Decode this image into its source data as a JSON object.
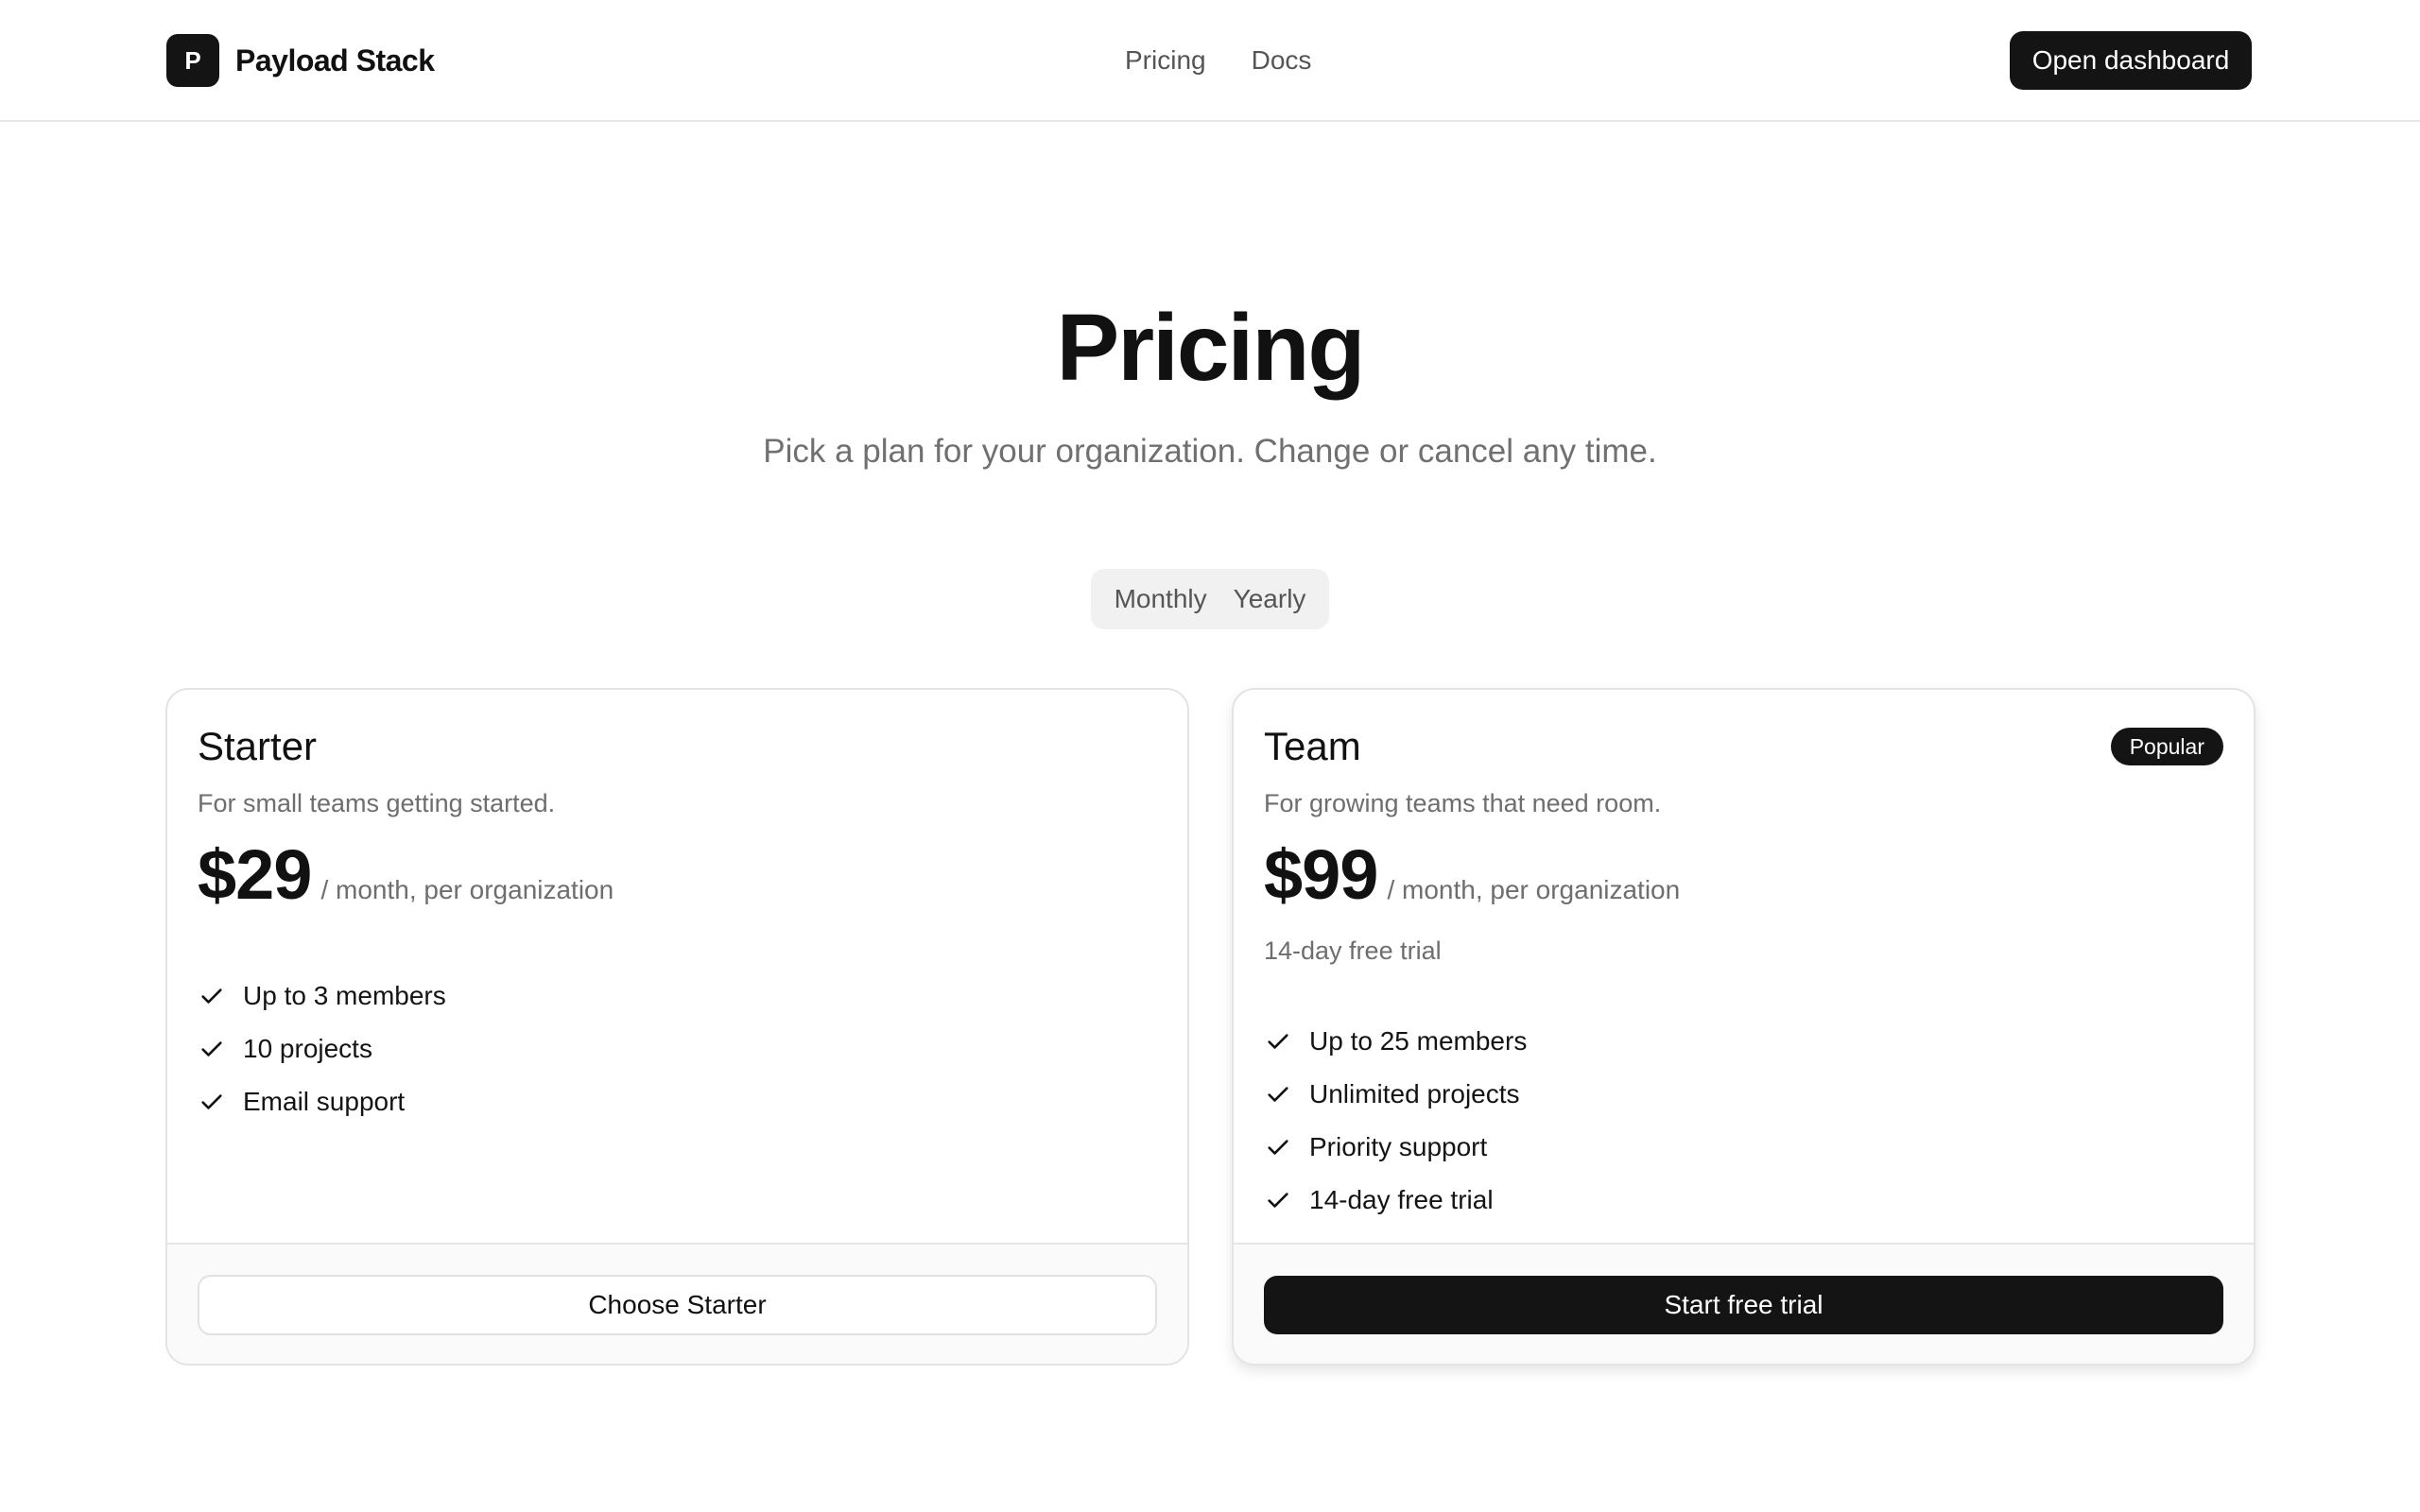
{
  "header": {
    "brand_initial": "P",
    "brand_name": "Payload Stack",
    "nav": [
      {
        "label": "Pricing"
      },
      {
        "label": "Docs"
      }
    ],
    "cta_label": "Open dashboard"
  },
  "hero": {
    "title": "Pricing",
    "subtitle": "Pick a plan for your organization. Change or cancel any time."
  },
  "billing_toggle": {
    "options": [
      "Monthly",
      "Yearly"
    ]
  },
  "plans": [
    {
      "name": "Starter",
      "description": "For small teams getting started.",
      "price": "$29",
      "period": "/ month, per organization",
      "features": [
        "Up to 3 members",
        "10 projects",
        "Email support"
      ],
      "cta_label": "Choose Starter"
    },
    {
      "name": "Team",
      "badge": "Popular",
      "description": "For growing teams that need room.",
      "price": "$99",
      "period": "/ month, per organization",
      "trial_note": "14-day free trial",
      "features": [
        "Up to 25 members",
        "Unlimited projects",
        "Priority support",
        "14-day free trial"
      ],
      "cta_label": "Start free trial"
    }
  ],
  "icons": {
    "feature": "check-icon"
  },
  "colors": {
    "primary": "#141414",
    "muted_text": "#6e6e6e",
    "border": "#e4e4e4",
    "toggle_bg": "#f1f1f1"
  }
}
